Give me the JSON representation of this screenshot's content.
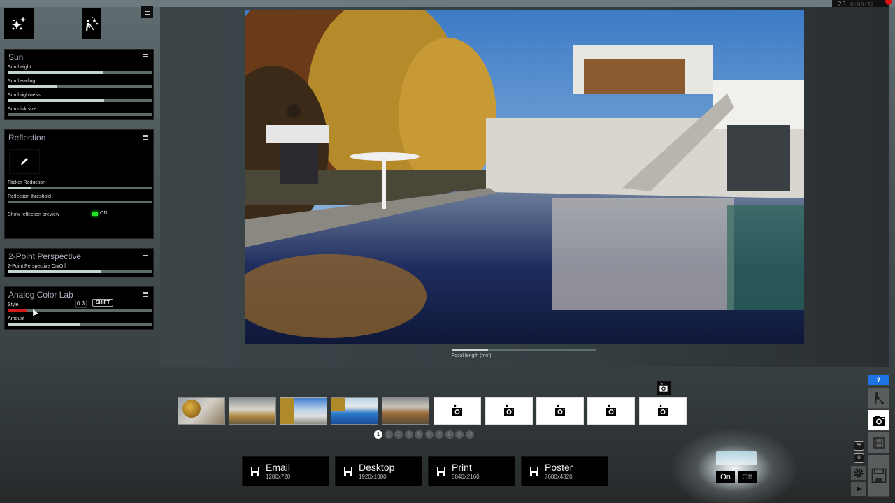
{
  "status": {
    "fps": "25",
    "timecode": "0:00:32"
  },
  "toolbar": {
    "tool_effects": "effects-sparkle-icon",
    "tool_cleanup": "cleanup-sweep-icon"
  },
  "panels": {
    "sun": {
      "title": "Sun",
      "sliders": [
        {
          "label": "Sun height",
          "value": 0.66
        },
        {
          "label": "Sun heading",
          "value": 0.34
        },
        {
          "label": "Sun brightness",
          "value": 0.67
        },
        {
          "label": "Sun disk size",
          "value": 0.0
        }
      ]
    },
    "reflection": {
      "title": "Reflection",
      "sliders": [
        {
          "label": "Flicker Reduction",
          "value": 0.16
        },
        {
          "label": "Reflection threshold",
          "value": 0.0
        }
      ],
      "toggle_label": "Show reflection preview",
      "toggle_state": "ON"
    },
    "perspective": {
      "title": "2-Point Perspective",
      "sliders": [
        {
          "label": "2-Point Perspective On/Off",
          "value": 0.65
        }
      ]
    },
    "color_lab": {
      "title": "Analog Color Lab",
      "style_label": "Style",
      "style_value": "0.3",
      "style_fraction": 0.13,
      "shift_label": "SHIFT",
      "amount_label": "Amount",
      "amount_value": 0.5
    }
  },
  "viewport": {
    "focal_label": "Focal length (mm)",
    "focal_value": 0.25
  },
  "thumbnails": {
    "filled": [
      "Interior view 1",
      "Interior view 2",
      "Exterior view 3",
      "Pool view 4",
      "Interior view 5"
    ],
    "empty_slots": 5
  },
  "pager": {
    "pages": [
      "1",
      "2",
      "3",
      "4",
      "5",
      "6",
      "7",
      "8",
      "9",
      "10"
    ],
    "active": 0
  },
  "export": [
    {
      "name": "Email",
      "res": "1280x720"
    },
    {
      "name": "Desktop",
      "res": "1920x1080"
    },
    {
      "name": "Print",
      "res": "3840x2160"
    },
    {
      "name": "Poster",
      "res": "7680x4320"
    }
  ],
  "light": {
    "on": "On",
    "off": "Off"
  },
  "dock": {
    "help": "?",
    "key_f8": "F8",
    "key_u": "U"
  },
  "colors": {
    "accent_blue": "#1d74e0",
    "led_green": "#22e022",
    "style_red": "#d21c1c"
  }
}
